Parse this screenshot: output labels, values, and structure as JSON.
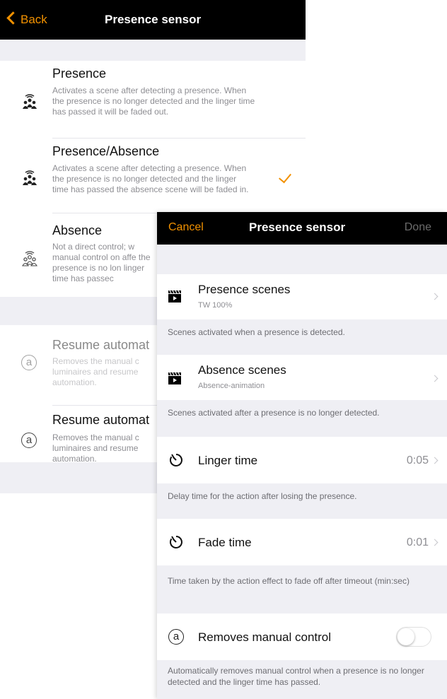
{
  "back_screen": {
    "nav": {
      "back_label": "Back",
      "title": "Presence sensor"
    },
    "options": [
      {
        "title": "Presence",
        "description": "Activates a scene after detecting a presence. When the presence is no longer detected and the linger time has passed it will be faded out.",
        "icon": "presence-people-icon",
        "checked": false
      },
      {
        "title": "Presence/Absence",
        "description": "Activates a scene after detecting a presence. When the presence is no longer detected and the linger time has passed the absence scene will be faded in.",
        "icon": "presence-people-icon",
        "checked": true
      },
      {
        "title": "Absence",
        "description": "Not a direct control; w manual control on affe the presence is no lon linger time has passec",
        "icon": "absence-people-icon",
        "checked": false
      }
    ],
    "resume": [
      {
        "title": "Resume automat",
        "description": "Removes the manual c luminaires and resume automation.",
        "enabled": false
      },
      {
        "title": "Resume automat",
        "description": "Removes the manual c luminaires and resume automation.",
        "enabled": true
      }
    ]
  },
  "front_screen": {
    "nav": {
      "cancel_label": "Cancel",
      "title": "Presence sensor",
      "done_label": "Done"
    },
    "presence_scenes": {
      "title": "Presence scenes",
      "subtitle": "TW 100%",
      "footer": "Scenes activated when a presence is detected."
    },
    "absence_scenes": {
      "title": "Absence scenes",
      "subtitle": "Absence-animation",
      "footer": "Scenes activated after a presence is no longer detected."
    },
    "linger_time": {
      "title": "Linger time",
      "value": "0:05",
      "footer": "Delay time for the action after losing the presence."
    },
    "fade_time": {
      "title": "Fade time",
      "value": "0:01",
      "footer": "Time taken by the action effect to fade off after timeout (min:sec)"
    },
    "manual_control": {
      "title": "Removes manual control",
      "toggle_on": false,
      "footer": "Automatically removes manual control when a presence is no longer detected and the linger time has passed."
    },
    "colors": {
      "accent": "#f29100",
      "navbar": "#000000",
      "background": "#efeff4"
    }
  }
}
